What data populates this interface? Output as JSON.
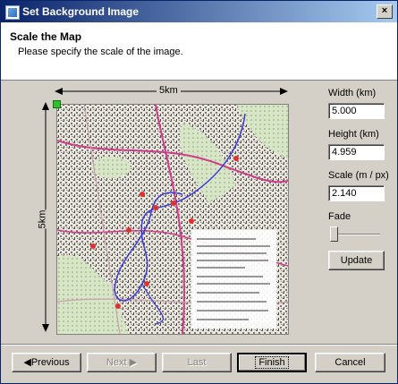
{
  "window": {
    "title": "Set Background Image",
    "close_glyph": "×",
    "icon": "app-icon"
  },
  "header": {
    "title": "Scale the Map",
    "subtitle": "Please specify the scale of the image."
  },
  "map": {
    "width_label": "5km",
    "height_label": "5km"
  },
  "fields": {
    "width_label": "Width (km)",
    "width_value": "5.000",
    "height_label": "Height (km)",
    "height_value": "4.959",
    "scale_label": "Scale (m / px)",
    "scale_value": "2.140",
    "fade_label": "Fade",
    "fade_level": 0,
    "update_label": "Update"
  },
  "buttons": {
    "previous": "◀Previous",
    "next": "Next ▶",
    "last": "Last",
    "finish": "Finish",
    "cancel": "Cancel"
  },
  "colors": {
    "title_start": "#0a246a",
    "title_end": "#a6caf0",
    "route": "#3a3ad8",
    "checkpoint": "#e03030",
    "road": "#d23a8a"
  }
}
